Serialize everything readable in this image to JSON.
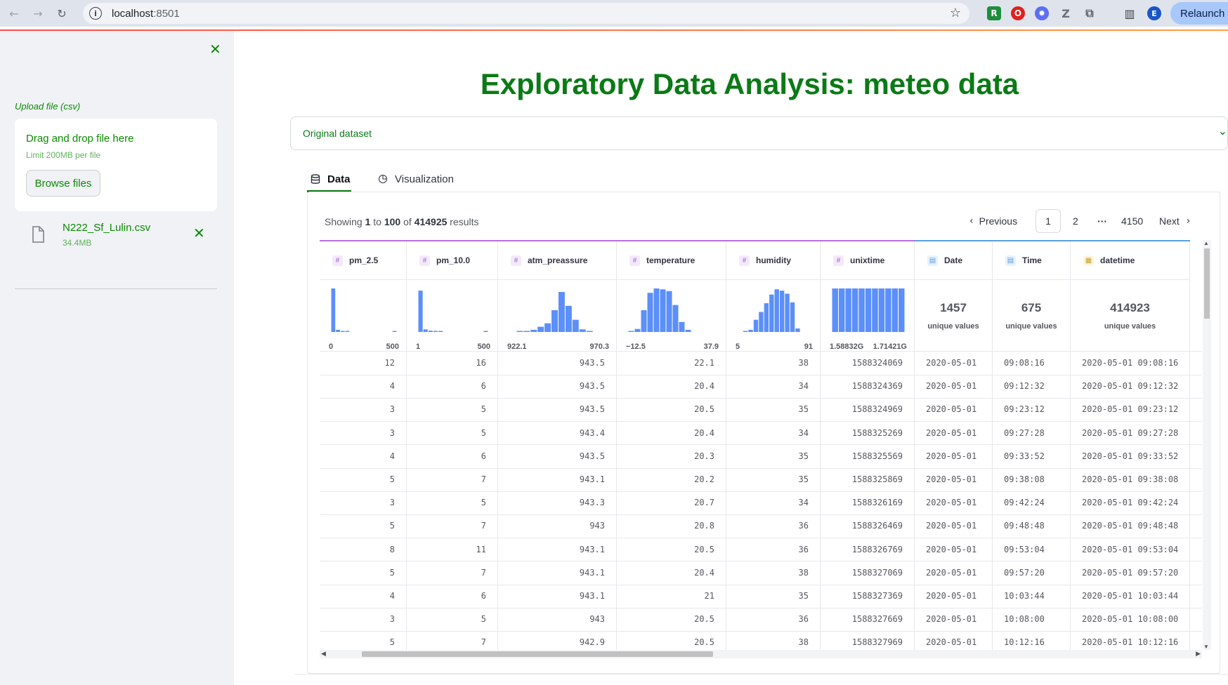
{
  "browser": {
    "url_host": "localhost",
    "url_port": ":8501",
    "relaunch_label": "Relaunch t",
    "extensions": [
      {
        "name": "r-extension-icon",
        "letter": "R",
        "color": "#1e8e3e"
      },
      {
        "name": "opera-extension-icon",
        "letter": "O",
        "color": "#e0201f"
      },
      {
        "name": "gear-extension-icon",
        "letter": "✹",
        "color": "#5b6ef5"
      },
      {
        "name": "z-extension-icon",
        "letter": "Z",
        "color": "#6b6f76"
      },
      {
        "name": "puzzle-extension-icon",
        "letter": "⧉",
        "color": "#5f6368"
      },
      {
        "name": "sidepanel-icon",
        "letter": "▥",
        "color": "#3c4043"
      },
      {
        "name": "profile-avatar-icon",
        "letter": "E",
        "color": "#1a56c7"
      }
    ]
  },
  "sidebar": {
    "upload_label": "Upload file (csv)",
    "dropzone_title": "Drag and drop file here",
    "dropzone_limit": "Limit 200MB per file",
    "browse_label": "Browse files",
    "file_name": "N222_Sf_Lulin.csv",
    "file_size": "34.4MB"
  },
  "main": {
    "title": "Exploratory Data Analysis: meteo data",
    "expander_label": "Original dataset",
    "tabs": [
      {
        "label": "Data",
        "icon": "database-icon"
      },
      {
        "label": "Visualization",
        "icon": "chart-pie-icon"
      }
    ]
  },
  "dataframe": {
    "info_prefix": "Showing ",
    "info_from": "1",
    "info_mid1": " to ",
    "info_to": "100",
    "info_mid2": " of ",
    "info_total": "414925",
    "info_suffix": " results",
    "pager": {
      "previous": "Previous",
      "page1": "1",
      "page2": "2",
      "ellipsis": "···",
      "last": "4150",
      "next": "Next"
    },
    "columns": [
      {
        "name": "pm_2.5",
        "type": "num",
        "kind": "hist",
        "min": "0",
        "max": "500",
        "bars": [
          1.0,
          0.05,
          0.02,
          0.01,
          0,
          0,
          0,
          0,
          0,
          0,
          0,
          0,
          0,
          0.01
        ]
      },
      {
        "name": "pm_10.0",
        "type": "num",
        "kind": "hist",
        "min": "1",
        "max": "500",
        "bars": [
          0.95,
          0.06,
          0.03,
          0.01,
          0.01,
          0,
          0,
          0,
          0,
          0,
          0,
          0,
          0,
          0.01
        ]
      },
      {
        "name": "atm_preassure",
        "type": "num",
        "kind": "hist",
        "min": "922.1",
        "max": "970.3",
        "bars": [
          0,
          0.01,
          0.02,
          0.05,
          0.12,
          0.2,
          0.5,
          0.92,
          0.6,
          0.28,
          0.06,
          0.02,
          0,
          0
        ]
      },
      {
        "name": "temperature",
        "type": "num",
        "kind": "hist",
        "min": "−12.5",
        "max": "37.9",
        "bars": [
          0.02,
          0.07,
          0.5,
          0.9,
          1.0,
          0.98,
          0.94,
          0.62,
          0.23,
          0.05,
          0,
          0,
          0,
          0
        ]
      },
      {
        "name": "humidity",
        "type": "num",
        "kind": "hist",
        "min": "5",
        "max": "91",
        "bars": [
          0,
          0.02,
          0.05,
          0.28,
          0.46,
          0.66,
          0.86,
          0.98,
          0.95,
          0.88,
          0.68,
          0.08,
          0,
          0
        ]
      },
      {
        "name": "unixtime",
        "type": "num",
        "kind": "hist",
        "min": "1.58832G",
        "max": "1.71421G",
        "bars": [
          1,
          1,
          1,
          1,
          1,
          1,
          1,
          1,
          1,
          1,
          1
        ]
      },
      {
        "name": "Date",
        "type": "txt",
        "kind": "unique",
        "unique": "1457",
        "unique_label": "unique values"
      },
      {
        "name": "Time",
        "type": "txt",
        "kind": "unique",
        "unique": "675",
        "unique_label": "unique values"
      },
      {
        "name": "datetime",
        "type": "dt",
        "kind": "unique",
        "unique": "414923",
        "unique_label": "unique values"
      }
    ],
    "rows": [
      [
        "12",
        "16",
        "943.5",
        "22.1",
        "38",
        "1588324069",
        "2020-05-01",
        "09:08:16",
        "2020-05-01 09:08:16"
      ],
      [
        "4",
        "6",
        "943.5",
        "20.4",
        "34",
        "1588324369",
        "2020-05-01",
        "09:12:32",
        "2020-05-01 09:12:32"
      ],
      [
        "3",
        "5",
        "943.5",
        "20.5",
        "35",
        "1588324969",
        "2020-05-01",
        "09:23:12",
        "2020-05-01 09:23:12"
      ],
      [
        "3",
        "5",
        "943.4",
        "20.4",
        "34",
        "1588325269",
        "2020-05-01",
        "09:27:28",
        "2020-05-01 09:27:28"
      ],
      [
        "4",
        "6",
        "943.5",
        "20.3",
        "35",
        "1588325569",
        "2020-05-01",
        "09:33:52",
        "2020-05-01 09:33:52"
      ],
      [
        "5",
        "7",
        "943.1",
        "20.2",
        "35",
        "1588325869",
        "2020-05-01",
        "09:38:08",
        "2020-05-01 09:38:08"
      ],
      [
        "3",
        "5",
        "943.3",
        "20.7",
        "34",
        "1588326169",
        "2020-05-01",
        "09:42:24",
        "2020-05-01 09:42:24"
      ],
      [
        "5",
        "7",
        "943",
        "20.8",
        "36",
        "1588326469",
        "2020-05-01",
        "09:48:48",
        "2020-05-01 09:48:48"
      ],
      [
        "8",
        "11",
        "943.1",
        "20.5",
        "36",
        "1588326769",
        "2020-05-01",
        "09:53:04",
        "2020-05-01 09:53:04"
      ],
      [
        "5",
        "7",
        "943.1",
        "20.4",
        "38",
        "1588327069",
        "2020-05-01",
        "09:57:20",
        "2020-05-01 09:57:20"
      ],
      [
        "4",
        "6",
        "943.1",
        "21",
        "35",
        "1588327369",
        "2020-05-01",
        "10:03:44",
        "2020-05-01 10:03:44"
      ],
      [
        "3",
        "5",
        "943",
        "20.5",
        "36",
        "1588327669",
        "2020-05-01",
        "10:08:00",
        "2020-05-01 10:08:00"
      ],
      [
        "5",
        "7",
        "942.9",
        "20.5",
        "38",
        "1588327969",
        "2020-05-01",
        "10:12:16",
        "2020-05-01 10:12:16"
      ]
    ]
  },
  "colors": {
    "accent_green": "#0b7a16",
    "hist_bar": "#5b8ff9",
    "num_col_accent": "#b86fe0",
    "txt_col_accent": "#5a9ee0"
  }
}
